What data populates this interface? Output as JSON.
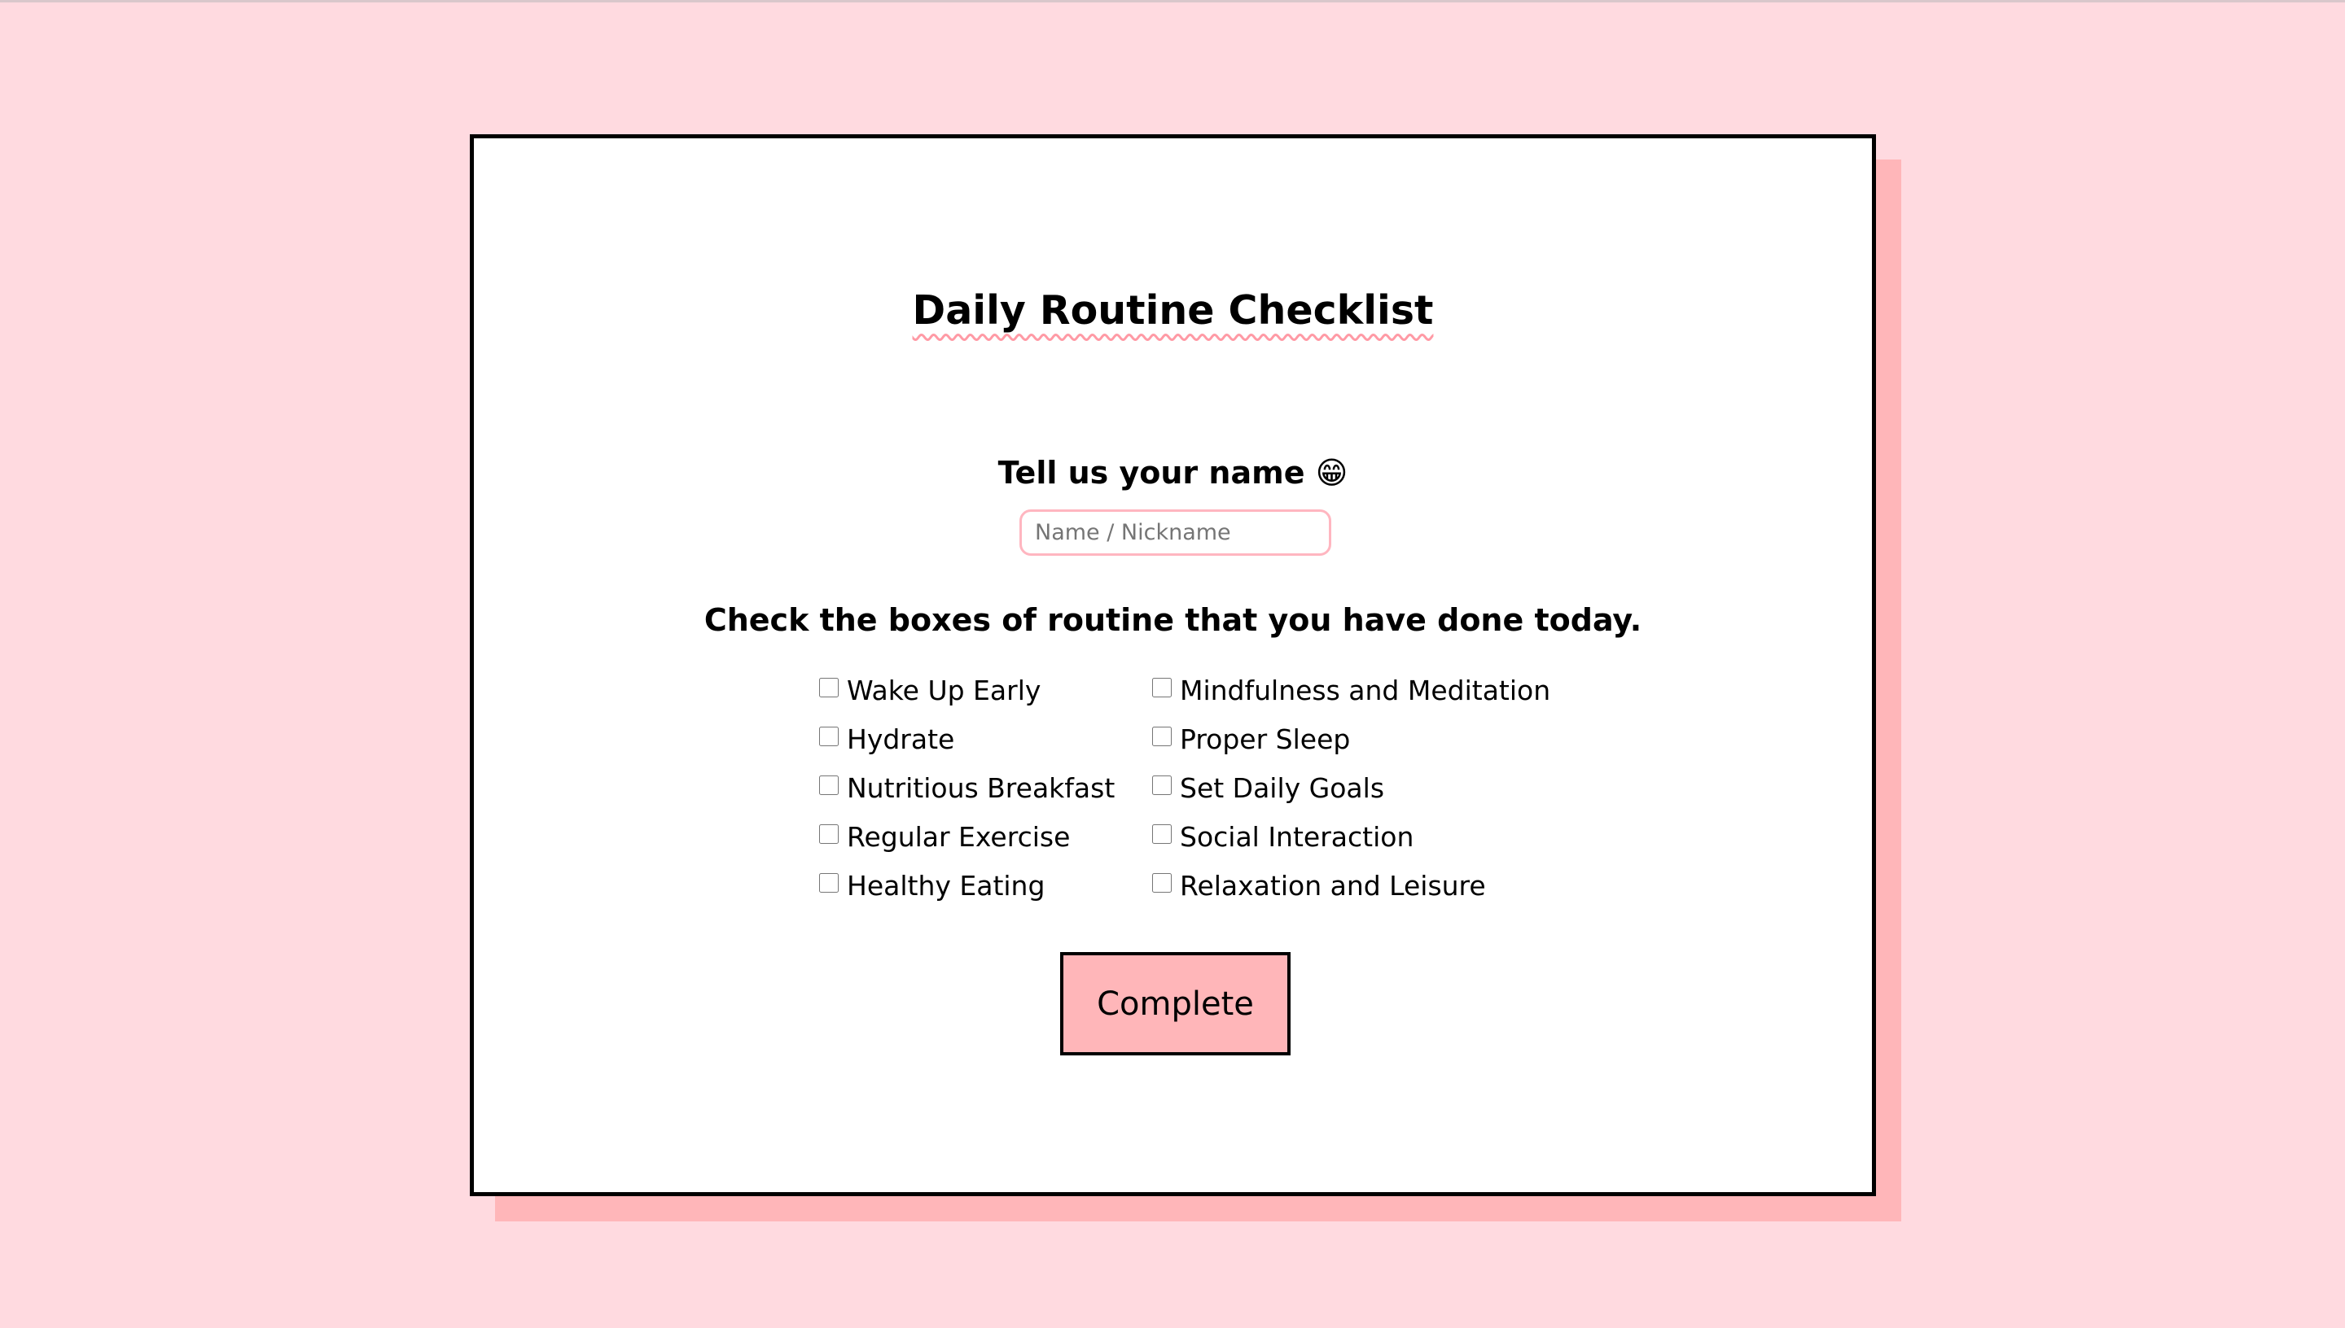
{
  "page": {
    "title": "Daily Routine Checklist",
    "name_label": "Tell us your name 😁",
    "name_placeholder": "Name / Nickname",
    "name_value": "",
    "instruction": "Check the boxes of routine that you have done today."
  },
  "checklist": {
    "left": [
      {
        "label": "Wake Up Early",
        "checked": false
      },
      {
        "label": "Hydrate",
        "checked": false
      },
      {
        "label": "Nutritious Breakfast",
        "checked": false
      },
      {
        "label": "Regular Exercise",
        "checked": false
      },
      {
        "label": "Healthy Eating",
        "checked": false
      }
    ],
    "right": [
      {
        "label": "Mindfulness and Meditation",
        "checked": false
      },
      {
        "label": "Proper Sleep",
        "checked": false
      },
      {
        "label": "Set Daily Goals",
        "checked": false
      },
      {
        "label": "Social Interaction",
        "checked": false
      },
      {
        "label": "Relaxation and Leisure",
        "checked": false
      }
    ]
  },
  "actions": {
    "complete_label": "Complete"
  },
  "colors": {
    "background": "#ffdae0",
    "card": "#ffffff",
    "accent": "#ffb6b9",
    "border": "#000000",
    "input_border": "#ffb6c0"
  }
}
